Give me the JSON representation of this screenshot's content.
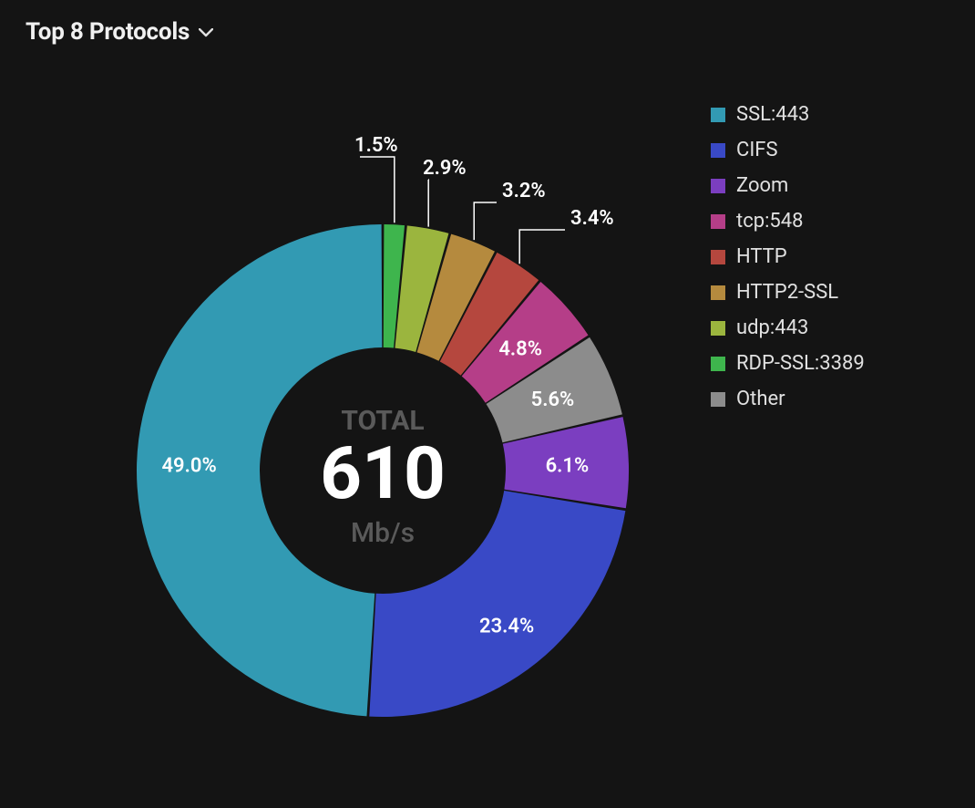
{
  "header": {
    "title": "Top 8 Protocols"
  },
  "center": {
    "label": "TOTAL",
    "value": "610",
    "unit": "Mb/s"
  },
  "legend_labels": {
    "0": "SSL:443",
    "1": "CIFS",
    "2": "Zoom",
    "3": "tcp:548",
    "4": "HTTP",
    "5": "HTTP2-SSL",
    "6": "udp:443",
    "7": "RDP-SSL:3389",
    "8": "Other"
  },
  "slice_labels": {
    "ssl443": "49.0%",
    "cifs": "23.4%",
    "zoom": "6.1%",
    "other": "5.6%",
    "tcp548": "4.8%",
    "http": "3.4%",
    "http2ssl": "3.2%",
    "udp443": "2.9%",
    "rdpssl": "1.5%"
  },
  "chart_data": {
    "type": "pie",
    "title": "Top 8 Protocols",
    "total_label": "TOTAL",
    "total_value": 610,
    "total_unit": "Mb/s",
    "series": [
      {
        "name": "SSL:443",
        "value": 49.0,
        "color": "#329ab3"
      },
      {
        "name": "CIFS",
        "value": 23.4,
        "color": "#3949c6"
      },
      {
        "name": "Zoom",
        "value": 6.1,
        "color": "#7b3ec0"
      },
      {
        "name": "Other",
        "value": 5.6,
        "color": "#8c8c8c"
      },
      {
        "name": "tcp:548",
        "value": 4.8,
        "color": "#b53e88"
      },
      {
        "name": "HTTP",
        "value": 3.4,
        "color": "#b5473e"
      },
      {
        "name": "HTTP2-SSL",
        "value": 3.2,
        "color": "#b58a3e"
      },
      {
        "name": "udp:443",
        "value": 2.9,
        "color": "#9bb53e"
      },
      {
        "name": "RDP-SSL:3389",
        "value": 1.5,
        "color": "#3eb54d"
      }
    ],
    "legend_order": [
      "SSL:443",
      "CIFS",
      "Zoom",
      "tcp:548",
      "HTTP",
      "HTTP2-SSL",
      "udp:443",
      "RDP-SSL:3389",
      "Other"
    ],
    "colors": {
      "SSL:443": "#329ab3",
      "CIFS": "#3949c6",
      "Zoom": "#7b3ec0",
      "tcp:548": "#b53e88",
      "HTTP": "#b5473e",
      "HTTP2-SSL": "#b58a3e",
      "udp:443": "#9bb53e",
      "RDP-SSL:3389": "#3eb54d",
      "Other": "#8c8c8c"
    }
  }
}
